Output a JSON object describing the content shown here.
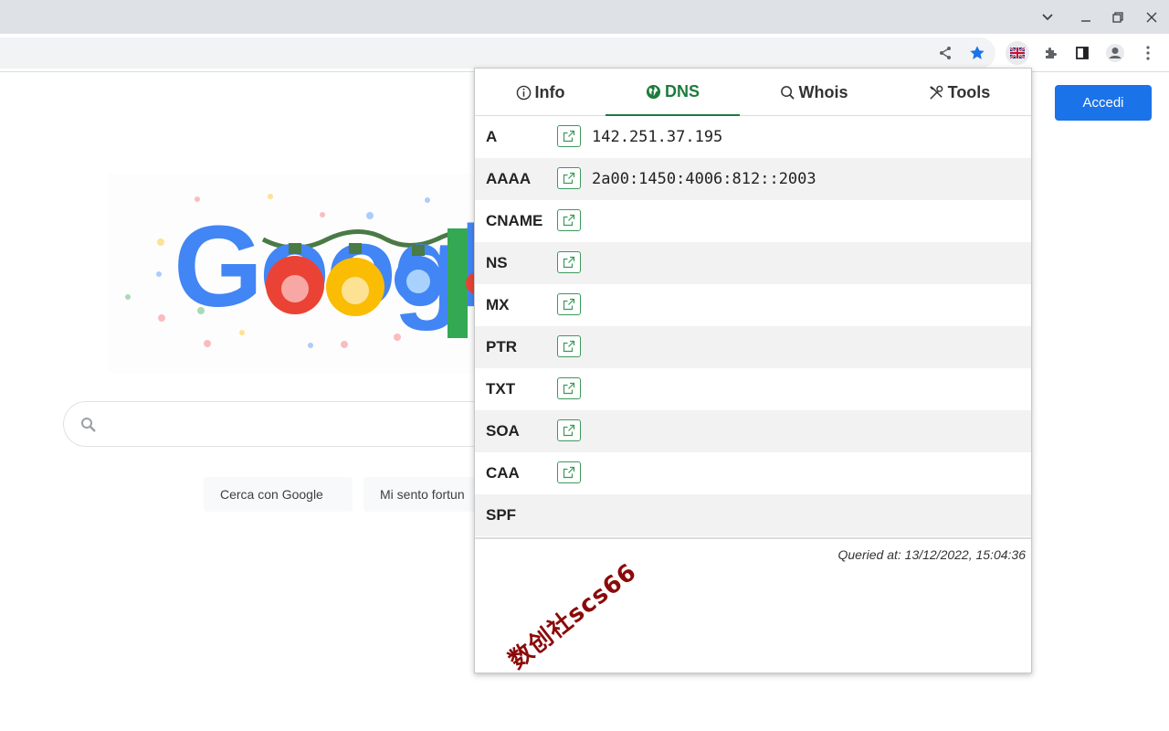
{
  "page": {
    "search_button": "Cerca con Google",
    "lucky_button": "Mi sento fortun",
    "signin_button": "Accedi",
    "doodle_text": "Googl"
  },
  "popup": {
    "tabs": [
      {
        "label": "Info",
        "icon": "info-icon"
      },
      {
        "label": "DNS",
        "icon": "globe-icon"
      },
      {
        "label": "Whois",
        "icon": "search-icon"
      },
      {
        "label": "Tools",
        "icon": "tools-icon"
      }
    ],
    "active_tab": "DNS",
    "records": [
      {
        "type": "A",
        "value": "142.251.37.195",
        "link": true
      },
      {
        "type": "AAAA",
        "value": "2a00:1450:4006:812::2003",
        "link": true
      },
      {
        "type": "CNAME",
        "value": "",
        "link": true
      },
      {
        "type": "NS",
        "value": "",
        "link": true
      },
      {
        "type": "MX",
        "value": "",
        "link": true
      },
      {
        "type": "PTR",
        "value": "",
        "link": true
      },
      {
        "type": "TXT",
        "value": "",
        "link": true
      },
      {
        "type": "SOA",
        "value": "",
        "link": true
      },
      {
        "type": "CAA",
        "value": "",
        "link": true
      },
      {
        "type": "SPF",
        "value": "",
        "link": false
      }
    ],
    "queried_at": "Queried at: 13/12/2022, 15:04:36"
  },
  "watermark": "数创社scs66",
  "colors": {
    "accent_green": "#1c7c3c",
    "signin_blue": "#1a73e8",
    "bookmark_star": "#1a73e8",
    "watermark": "#8b0a0a"
  }
}
